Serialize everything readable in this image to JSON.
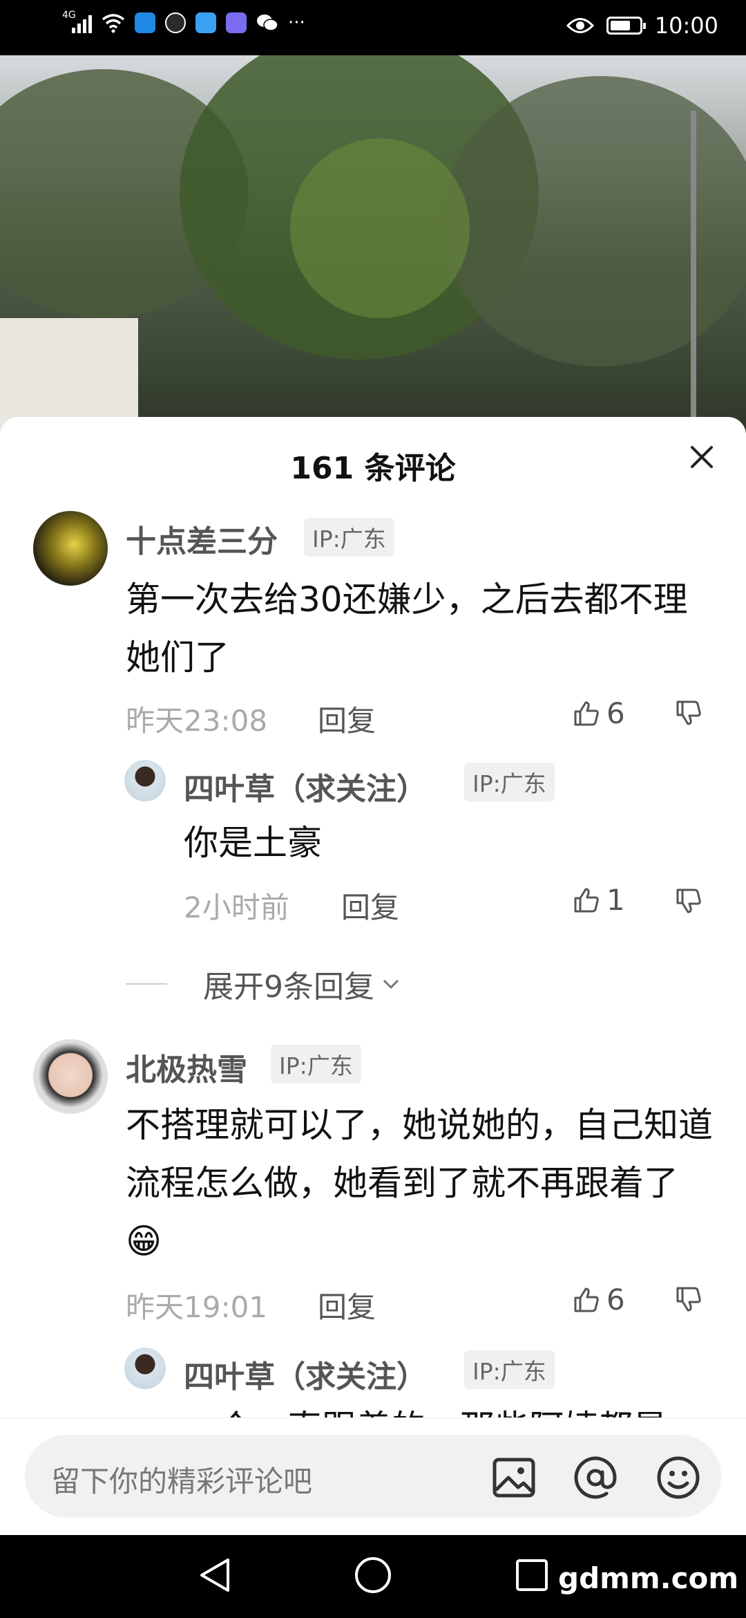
{
  "status_bar": {
    "network": "4G",
    "more": "···",
    "time": "10:00"
  },
  "sheet": {
    "title": "161 条评论",
    "close_icon": "close-icon"
  },
  "comments": [
    {
      "username": "十点差三分",
      "ip": "IP:广东",
      "text": "第一次去给30还嫌少，之后去都不理她们了",
      "time": "昨天23:08",
      "reply_label": "回复",
      "likes": "6"
    },
    {
      "username": "四叶草（求关注）",
      "ip": "IP:广东",
      "text": "你是土豪",
      "time": "2小时前",
      "reply_label": "回复",
      "likes": "1"
    },
    {
      "expand_label": "展开9条回复"
    },
    {
      "username": "北极热雪",
      "ip": "IP:广东",
      "text": "不搭理就可以了，她说她的，自己知道流程怎么做，她看到了就不再跟着了😁",
      "time": "昨天19:01",
      "reply_label": "回复",
      "likes": "6"
    },
    {
      "username": "四叶草（求关注）",
      "ip": "IP:广东",
      "text": "一个一直跟着的，那些阿姨都是"
    }
  ],
  "input_bar": {
    "placeholder": "留下你的精彩评论吧",
    "icons": [
      "image-icon",
      "at-icon",
      "emoji-icon"
    ]
  },
  "nav_bar": {
    "watermark": "gdmm.com"
  }
}
